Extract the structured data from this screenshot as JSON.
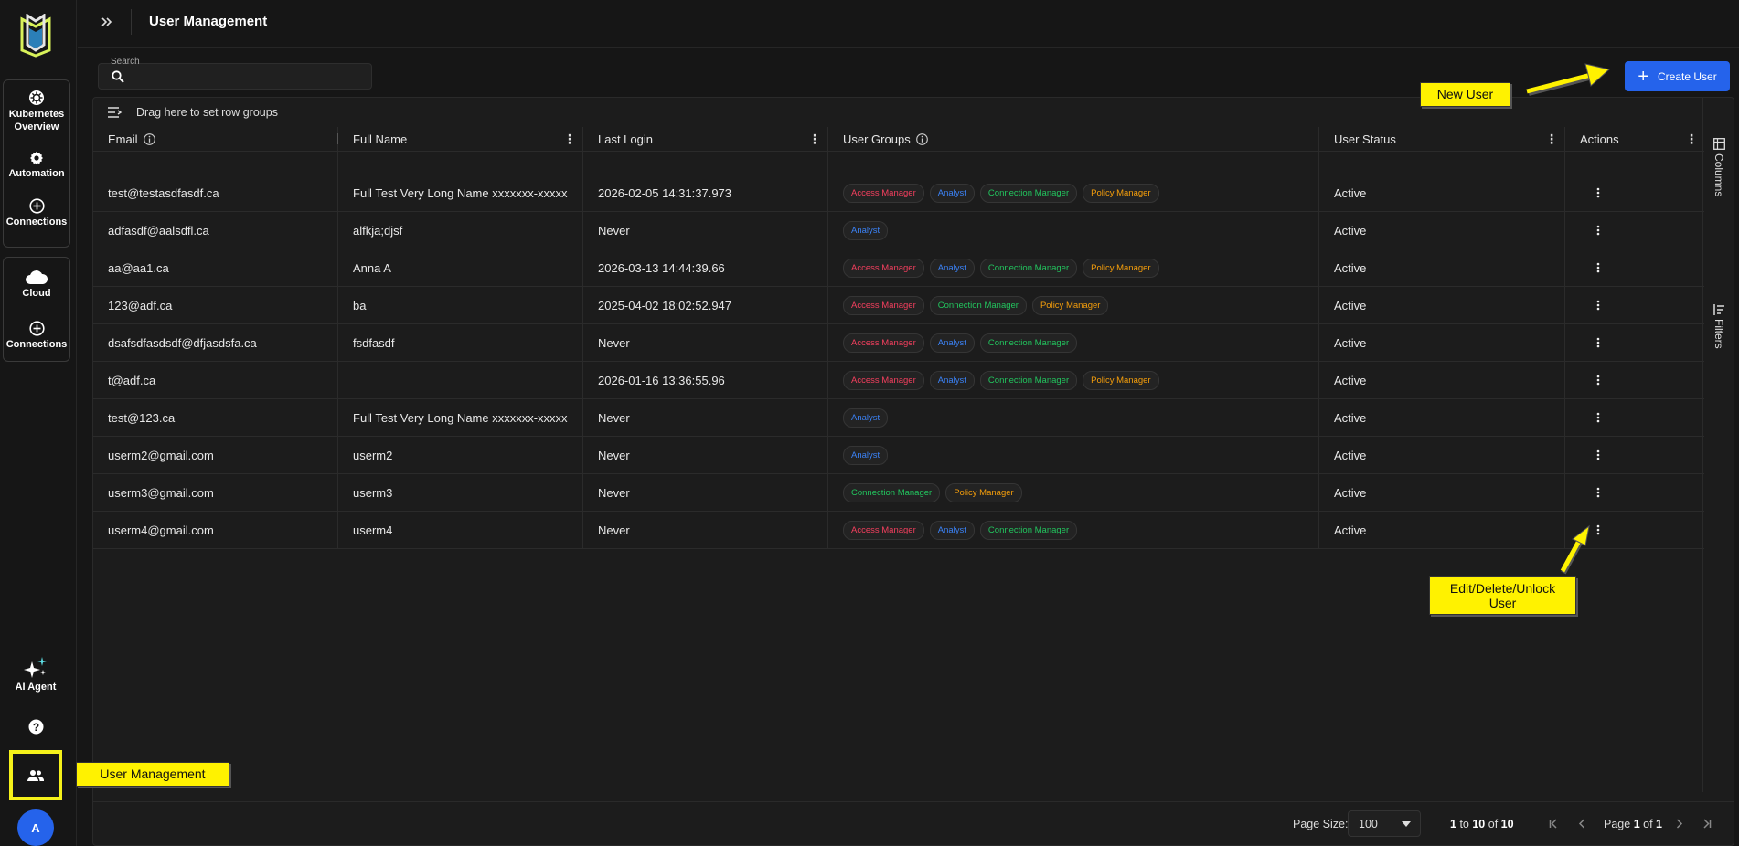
{
  "app": {
    "avatar_initial": "A"
  },
  "header": {
    "title": "User Management"
  },
  "nav": {
    "group1": [
      {
        "label_line1": "Kubernetes",
        "label_line2": "Overview",
        "icon": "helm-wheel-icon"
      },
      {
        "label_line1": "Automation",
        "label_line2": "",
        "icon": "gear-icon"
      },
      {
        "label_line1": "Connections",
        "label_line2": "",
        "icon": "plus-circle-icon"
      }
    ],
    "group2": [
      {
        "label_line1": "Cloud",
        "label_line2": "",
        "icon": "cloud-icon"
      },
      {
        "label_line1": "Connections",
        "label_line2": "",
        "icon": "plus-circle-icon"
      }
    ],
    "ai_agent": "AI Agent"
  },
  "search": {
    "label": "Search",
    "value": ""
  },
  "toolbar": {
    "create_label": "Create User"
  },
  "grid": {
    "group_bar": "Drag here to set row groups",
    "columns": [
      "Email",
      "Full Name",
      "Last Login",
      "User Groups",
      "User Status",
      "Actions"
    ],
    "side_tabs": [
      "Columns",
      "Filters"
    ],
    "rows": [
      {
        "email": "test@testasdfasdf.ca",
        "full_name": "Full Test Very Long Name xxxxxxx-xxxxx",
        "last_login": "2026-02-05 14:31:37.973",
        "groups": [
          "Access Manager",
          "Analyst",
          "Connection Manager",
          "Policy Manager"
        ],
        "status": "Active"
      },
      {
        "email": "adfasdf@aalsdfl.ca",
        "full_name": "alfkja;djsf",
        "last_login": "Never",
        "groups": [
          "Analyst"
        ],
        "status": "Active"
      },
      {
        "email": "aa@aa1.ca",
        "full_name": "Anna A",
        "last_login": "2026-03-13 14:44:39.66",
        "groups": [
          "Access Manager",
          "Analyst",
          "Connection Manager",
          "Policy Manager"
        ],
        "status": "Active"
      },
      {
        "email": "123@adf.ca",
        "full_name": "ba",
        "last_login": "2025-04-02 18:02:52.947",
        "groups": [
          "Access Manager",
          "Connection Manager",
          "Policy Manager"
        ],
        "status": "Active"
      },
      {
        "email": "dsafsdfasdsdf@dfjasdsfa.ca",
        "full_name": "fsdfasdf",
        "last_login": "Never",
        "groups": [
          "Access Manager",
          "Analyst",
          "Connection Manager"
        ],
        "status": "Active"
      },
      {
        "email": "t@adf.ca",
        "full_name": "",
        "last_login": "2026-01-16 13:36:55.96",
        "groups": [
          "Access Manager",
          "Analyst",
          "Connection Manager",
          "Policy Manager"
        ],
        "status": "Active"
      },
      {
        "email": "test@123.ca",
        "full_name": "Full Test Very Long Name xxxxxxx-xxxxx",
        "last_login": "Never",
        "groups": [
          "Analyst"
        ],
        "status": "Active"
      },
      {
        "email": "userm2@gmail.com",
        "full_name": "userm2",
        "last_login": "Never",
        "groups": [
          "Analyst"
        ],
        "status": "Active"
      },
      {
        "email": "userm3@gmail.com",
        "full_name": "userm3",
        "last_login": "Never",
        "groups": [
          "Connection Manager",
          "Policy Manager"
        ],
        "status": "Active"
      },
      {
        "email": "userm4@gmail.com",
        "full_name": "userm4",
        "last_login": "Never",
        "groups": [
          "Access Manager",
          "Analyst",
          "Connection Manager"
        ],
        "status": "Active"
      }
    ]
  },
  "footer": {
    "page_size_label": "Page Size:",
    "page_size_value": "100",
    "range_start": "1",
    "range_to": "to",
    "range_end": "10",
    "range_of": "of",
    "range_total": "10",
    "page_label": "Page",
    "page_current": "1",
    "page_of": "of",
    "page_total": "1"
  },
  "callouts": {
    "new_user": "New User",
    "edit_user_line1": "Edit/Delete/Unlock",
    "edit_user_line2": "User",
    "user_management": "User Management"
  },
  "colors": {
    "accent": "#2563eb",
    "access_manager": "#f43f5e",
    "analyst": "#3b82f6",
    "connection_manager": "#22c55e",
    "policy_manager": "#f59e0b",
    "callout": "#fff200"
  }
}
